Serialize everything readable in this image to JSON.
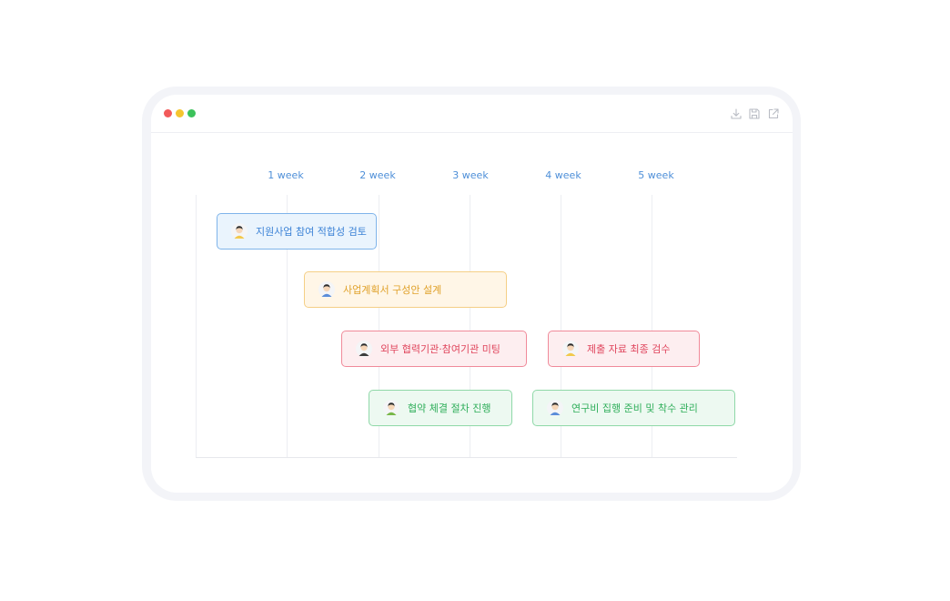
{
  "window": {
    "traffic_lights": [
      "#f25a5a",
      "#f5c52e",
      "#3cc25b"
    ],
    "toolbar_icons": [
      "download-icon",
      "save-icon",
      "share-icon"
    ]
  },
  "timeline": {
    "weeks": [
      "1 week",
      "2 week",
      "3 week",
      "4 week",
      "5 week"
    ],
    "week_color": "#4e8fd8"
  },
  "tasks": [
    {
      "label": "지원사업 참여 적합성 검토",
      "color": "#3b82d6",
      "bg": "#eaf4fd",
      "border": "#7fb4ea",
      "avatar": "person-icon"
    },
    {
      "label": "사업계획서 구성안 설계",
      "color": "#e0a12a",
      "bg": "#fff6e7",
      "border": "#f5cf86",
      "avatar": "person-icon"
    },
    {
      "label": "외부 협력기관·참여기관 미팅",
      "color": "#e0455d",
      "bg": "#fdeef0",
      "border": "#f08a9a",
      "avatar": "person-icon"
    },
    {
      "label": "제출 자료 최종 검수",
      "color": "#e0455d",
      "bg": "#fdeef0",
      "border": "#f08a9a",
      "avatar": "person-icon"
    },
    {
      "label": "협약 체결 절차 진행",
      "color": "#2fae5a",
      "bg": "#edf9f1",
      "border": "#8fd8a8",
      "avatar": "person-icon"
    },
    {
      "label": "연구비 집행 준비 및 착수 관리",
      "color": "#2fae5a",
      "bg": "#edf9f1",
      "border": "#8fd8a8",
      "avatar": "person-icon"
    }
  ]
}
